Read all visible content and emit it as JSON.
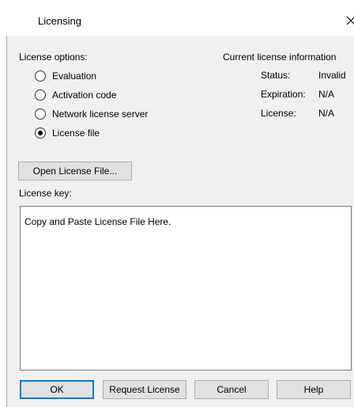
{
  "window": {
    "title": "Licensing"
  },
  "options": {
    "heading": "License options:",
    "items": [
      {
        "label": "Evaluation",
        "checked": false
      },
      {
        "label": "Activation code",
        "checked": false
      },
      {
        "label": "Network license server",
        "checked": false
      },
      {
        "label": "License file",
        "checked": true
      }
    ]
  },
  "info": {
    "heading": "Current license information",
    "status_label": "Status:",
    "status_value": "Invalid",
    "expiration_label": "Expiration:",
    "expiration_value": "N/A",
    "license_label": "License:",
    "license_value": "N/A"
  },
  "open_file_button": "Open License File...",
  "key": {
    "label": "License key:",
    "value": "Copy and Paste License File Here."
  },
  "buttons": {
    "ok": "OK",
    "request": "Request License",
    "cancel": "Cancel",
    "help": "Help"
  },
  "colors": {
    "dialog_bg": "#f0f0f0",
    "default_button_border": "#0078d7"
  }
}
